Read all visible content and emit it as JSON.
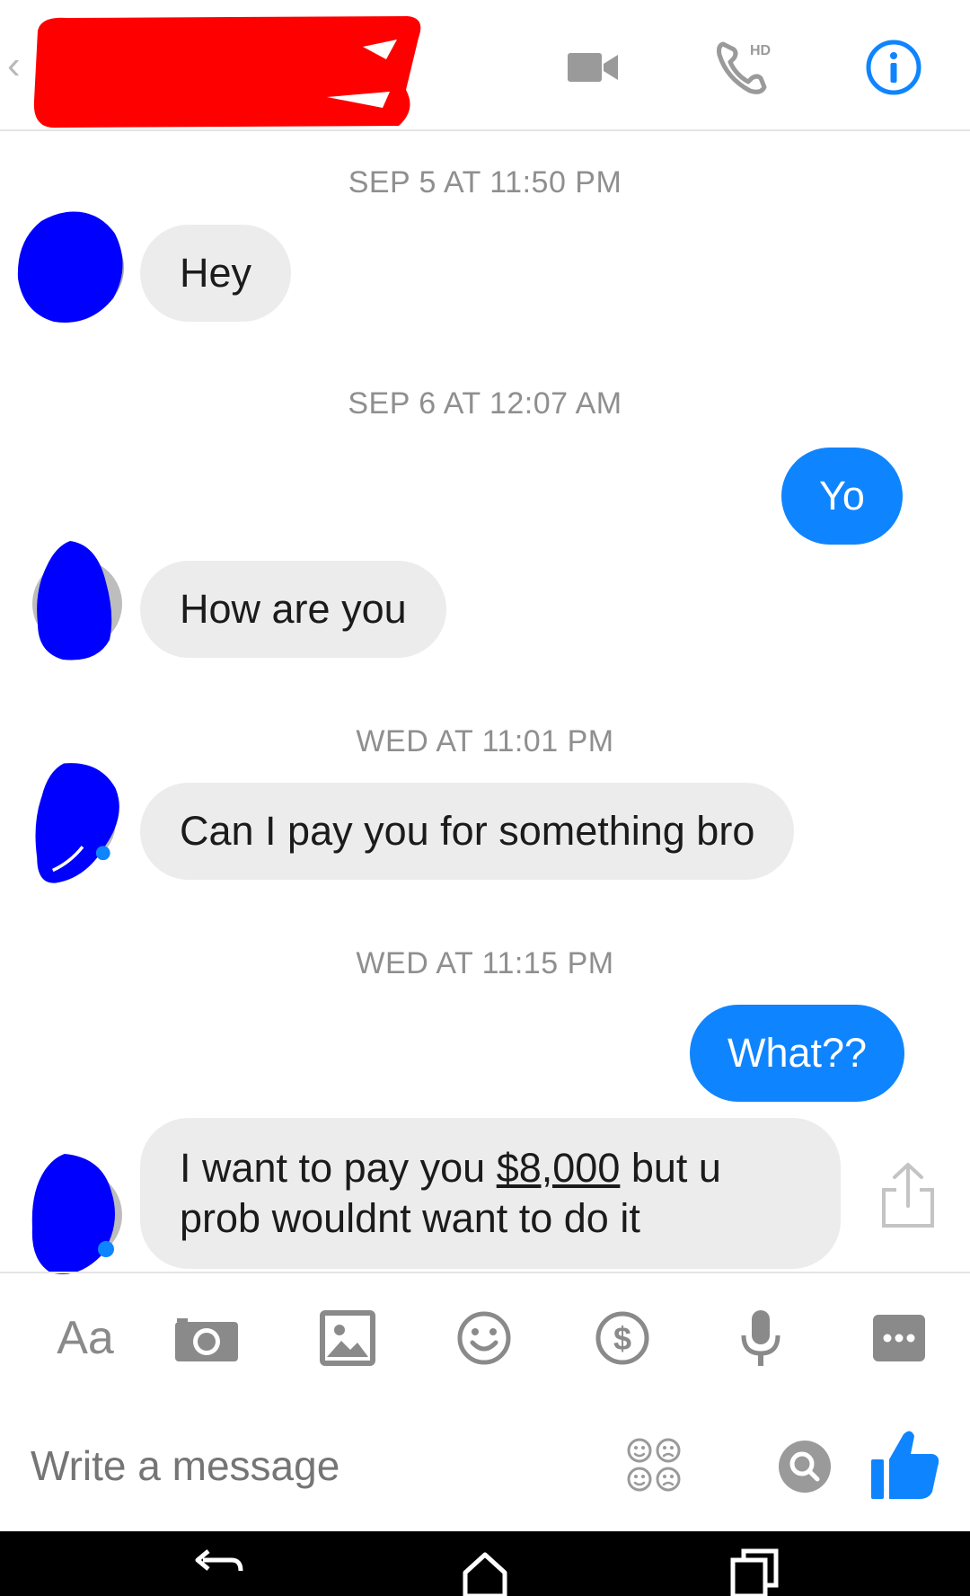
{
  "header": {
    "back_glyph": "‹",
    "video_icon": "video-camera-icon",
    "call_icon": "phone-hd-icon",
    "call_badge": "HD",
    "info_icon": "info-icon",
    "accent": "#0f84ff"
  },
  "thread": {
    "timestamps": [
      "SEP 5 AT 11:50 PM",
      "SEP 6 AT 12:07 AM",
      "WED AT 11:01 PM",
      "WED AT 11:15 PM"
    ],
    "messages": [
      {
        "sender": "them",
        "text": "Hey"
      },
      {
        "sender": "me",
        "text": "Yo"
      },
      {
        "sender": "them",
        "text": "How are you"
      },
      {
        "sender": "them",
        "text": "Can I pay you for something bro"
      },
      {
        "sender": "me",
        "text": "What??"
      },
      {
        "sender": "them",
        "text_before": "I want to pay you ",
        "amount": "$8,000",
        "text_after": " but u prob wouldnt want to do it"
      }
    ],
    "incoming_color": "#ececec",
    "outgoing_color": "#0f84ff"
  },
  "composer": {
    "text_button": "Aa",
    "placeholder": "Write a message",
    "icons": [
      "camera-icon",
      "gallery-icon",
      "emoji-icon",
      "payment-icon",
      "microphone-icon",
      "more-icon",
      "stickers-icon",
      "search-icon",
      "like-icon"
    ]
  }
}
